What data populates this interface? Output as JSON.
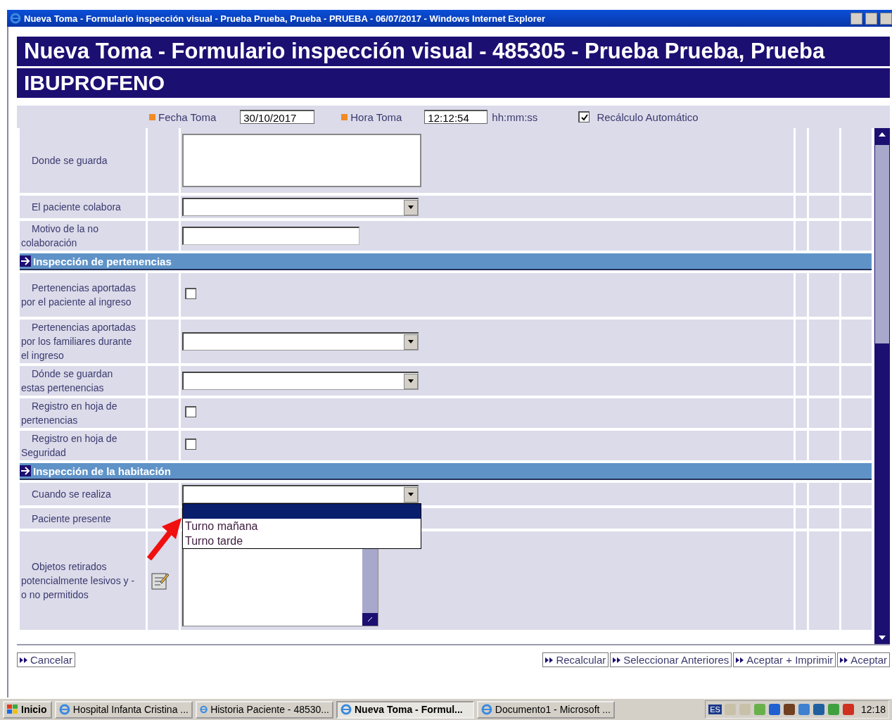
{
  "window": {
    "title": "Nueva Toma - Formulario inspección visual - Prueba Prueba, Prueba - PRUEBA - 06/07/2017 - Windows Internet Explorer"
  },
  "header": {
    "title": "Nueva Toma - Formulario inspección visual - 485305 - Prueba Prueba, Prueba",
    "subtitle": "IBUPROFENO"
  },
  "toolbar": {
    "date_label": "Fecha Toma",
    "date_value": "30/10/2017",
    "time_label": "Hora Toma",
    "time_value": "12:12:54",
    "time_format": "hh:mm:ss",
    "auto_recalc": {
      "label": "Recálculo Automático",
      "checked": true
    }
  },
  "rows": [
    {
      "kind": "textarea",
      "label": "Donde se guarda"
    },
    {
      "kind": "select",
      "label": "El paciente colabora"
    },
    {
      "kind": "text",
      "label": "Motivo de la no colaboración"
    },
    {
      "kind": "section",
      "label": "Inspección de pertenencias"
    },
    {
      "kind": "checkbox",
      "label": "Pertenencias aportadas por el paciente al ingreso",
      "checked": false
    },
    {
      "kind": "select",
      "label": "Pertenencias aportadas por los familiares durante el ingreso"
    },
    {
      "kind": "select",
      "label": "Dónde se guardan estas pertenencias"
    },
    {
      "kind": "checkbox",
      "label": "Registro en hoja de pertenencias",
      "checked": false
    },
    {
      "kind": "checkbox",
      "label": "Registro en hoja de Seguridad",
      "checked": false
    },
    {
      "kind": "section",
      "label": "Inspección de la habitación"
    },
    {
      "kind": "select",
      "label": "Cuando se realiza",
      "open": true,
      "blank_option_selected": true,
      "options": [
        {
          "label": "Turno mañana",
          "selected": false
        },
        {
          "label": "Turno tarde",
          "selected": false
        }
      ]
    },
    {
      "kind": "blank",
      "label": "Paciente presente"
    },
    {
      "kind": "editor",
      "label": "Objetos retirados potencialmente lesivos y - o no permitidos"
    }
  ],
  "buttons_left": [
    "Cancelar"
  ],
  "buttons_right": [
    "Recalcular",
    "Seleccionar Anteriores",
    "Aceptar + Imprimir",
    "Aceptar"
  ],
  "taskbar": {
    "start": "Inicio",
    "tasks": [
      {
        "label": "Hospital Infanta Cristina ...",
        "selected": false
      },
      {
        "label": "Historia Paciente - 48530...",
        "selected": false
      },
      {
        "label": "Nueva Toma - Formul...",
        "selected": true
      },
      {
        "label": "Documento1 - Microsoft ...",
        "selected": false
      }
    ],
    "language": "ES",
    "clock": "12:18"
  }
}
